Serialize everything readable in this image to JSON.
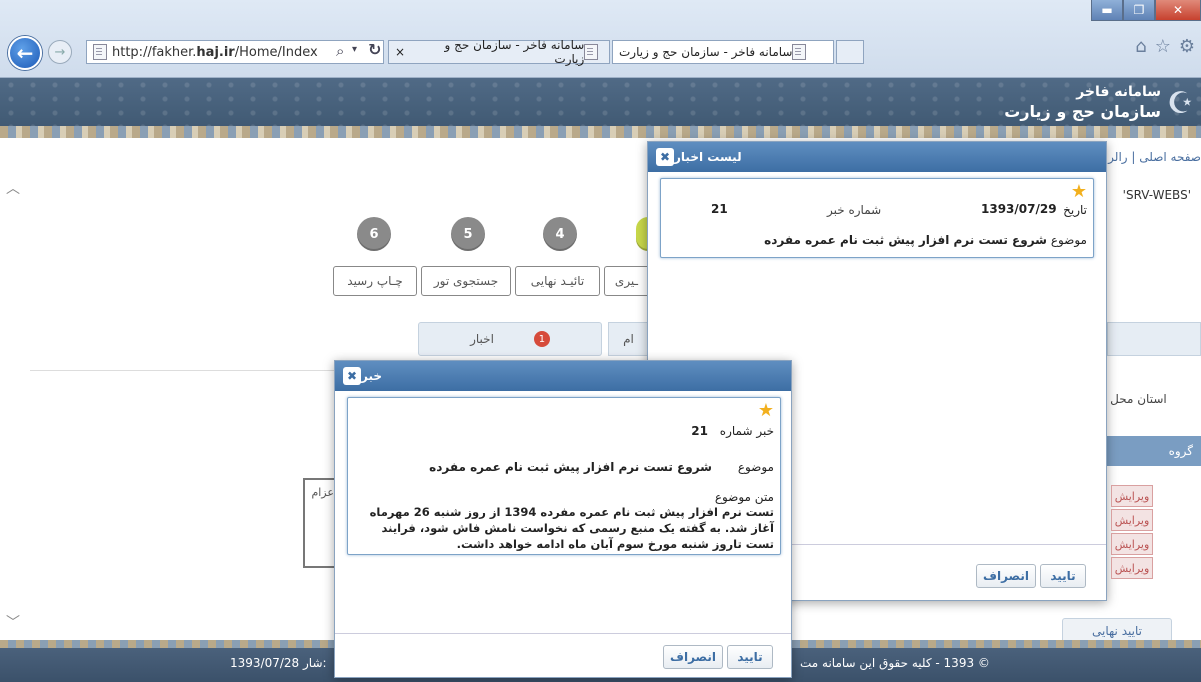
{
  "browser": {
    "url_prefix": "http://fakher.",
    "url_domain": "haj.ir",
    "url_path": "/Home/Index",
    "tabs": [
      {
        "label": "سامانه فاخر - سازمان حج و زیارت"
      },
      {
        "label": "سامانه فاخر - سازمان حج و زیارت"
      }
    ],
    "tab_close": "×",
    "search_icon": "⌕",
    "refresh_icon": "↻"
  },
  "site": {
    "title_line1": "سامانه فاخر",
    "title_line2": "سازمان حج و زیارت"
  },
  "page": {
    "breadcrumb": "صفحه اصلی | رالر گ",
    "server_text": "'SRV-WEBS'",
    "steps": [
      {
        "number": "6"
      },
      {
        "number": "5"
      },
      {
        "number": "4"
      }
    ],
    "step_buttons": [
      {
        "label": "چـاپ رسید"
      },
      {
        "label": "جستجوی تور"
      },
      {
        "label": "تائیـد نهایی"
      },
      {
        "label": "ـیری"
      }
    ],
    "news_tab_label": "اخبار",
    "news_badge": "1",
    "other_tab_partial": "ام",
    "province_label": "استان محل ا",
    "group_label": "گروه",
    "edit_labels": [
      "ویرایش",
      "ویرایش",
      "ویرایش",
      "ویرایش"
    ],
    "left_box_partial": "اعزام",
    "final_confirm_partial": "تایید نهایی"
  },
  "news_list_modal": {
    "title": "لیست اخبار",
    "item": {
      "date_label": "تاریخ",
      "date": "1393/07/29",
      "number_label": "شماره خبر",
      "number": "21",
      "subject_label": "موضوع",
      "subject": "شروع تست نرم افزار پیش ثبت نام عمره مفرده"
    },
    "confirm_label": "تایید",
    "cancel_label": "انصراف"
  },
  "news_modal": {
    "title": "خبر",
    "number_label": "خبر شماره",
    "number": "21",
    "subject_label": "موضوع",
    "subject": "شروع تست نرم افزار پیش ثبت نام عمره مفرده",
    "body_label": "متن موضوع",
    "body": "تست نرم افزار پیش ثبت نام عمره مفرده 1394 از روز شنبه 26 مهرماه آغاز شد. به گفته یک منبع رسمی که نخواست نامش فاش شود، فرایند تست تاروز شنبه مورخ سوم آبان ماه ادامه خواهد داشت.",
    "confirm_label": "تایید",
    "cancel_label": "انصراف"
  },
  "footer": {
    "date": "1393/07/28",
    "date_suffix": "شار:",
    "copyright": "© 1393 - کلیه حقوق این سامانه مت"
  }
}
